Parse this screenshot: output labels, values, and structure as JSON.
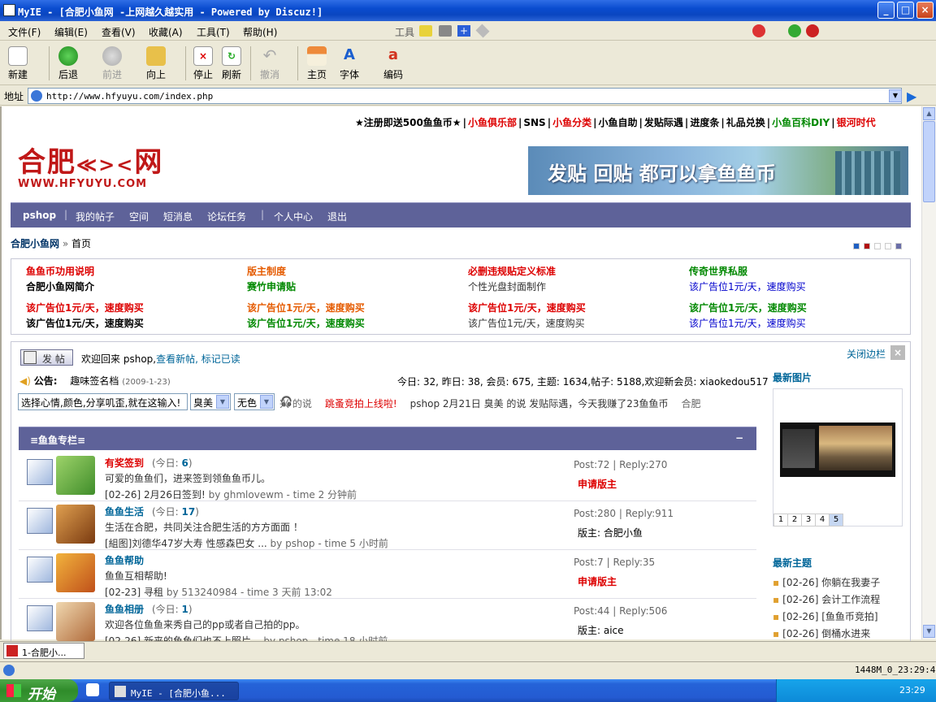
{
  "window": {
    "title": "MyIE - [合肥小鱼网 -上网越久越实用 - Powered by Discuz!]",
    "min": "_",
    "max": "□",
    "close": "×"
  },
  "menu": [
    "文件(F)",
    "编辑(E)",
    "查看(V)",
    "收藏(A)",
    "工具(T)",
    "帮助(H)"
  ],
  "menu_right_label": "工具",
  "toolbar": {
    "new": "新建",
    "back": "后退",
    "forward": "前进",
    "up": "向上",
    "stop": "停止",
    "refresh": "刷新",
    "undo": "撤消",
    "home": "主页",
    "font": "字体",
    "encoding": "编码"
  },
  "address": {
    "label": "地址",
    "url": "http://www.hfyuyu.com/index.php"
  },
  "toplinks": [
    {
      "text": "★注册即送500鱼鱼币★",
      "color": "#000"
    },
    {
      "text": "|",
      "color": "#000"
    },
    {
      "text": "小鱼俱乐部",
      "color": "#d00"
    },
    {
      "text": "|",
      "color": "#000"
    },
    {
      "text": "SNS",
      "color": "#000"
    },
    {
      "text": "|",
      "color": "#000"
    },
    {
      "text": "小鱼分类",
      "color": "#d00"
    },
    {
      "text": "|",
      "color": "#000"
    },
    {
      "text": "小鱼自助",
      "color": "#000"
    },
    {
      "text": "|",
      "color": "#000"
    },
    {
      "text": "发贴际遇",
      "color": "#000"
    },
    {
      "text": "|",
      "color": "#000"
    },
    {
      "text": "进度条",
      "color": "#000"
    },
    {
      "text": "|",
      "color": "#000"
    },
    {
      "text": "礼品兑换",
      "color": "#000"
    },
    {
      "text": "|",
      "color": "#000"
    },
    {
      "text": "小鱼百科DIY",
      "color": "#080"
    },
    {
      "text": "|",
      "color": "#000"
    },
    {
      "text": "银河时代",
      "color": "#d00"
    }
  ],
  "logo": {
    "name": "合肥",
    "fish": "≪><",
    "suffix": "网",
    "url": "WWW.HFYUYU.COM"
  },
  "banner": {
    "text": "发贴 回贴 都可以拿鱼鱼币"
  },
  "nav": {
    "user": "pshop",
    "items": [
      "我的帖子",
      "空间",
      "短消息",
      "论坛任务",
      "个人中心",
      "退出"
    ],
    "sep": "|"
  },
  "breadcrumb": {
    "home": "合肥小鱼网",
    "sep": "»",
    "current": "首页"
  },
  "style_colors": [
    "#1f5fc2",
    "#b01010",
    "#ffffff",
    "#ffffff",
    "#6a6ea8"
  ],
  "ads": [
    {
      "text": "鱼鱼币功用说明",
      "color": "#d00"
    },
    {
      "text": "版主制度",
      "color": "#e55b00"
    },
    {
      "text": "必删违规贴定义标准",
      "color": "#d00"
    },
    {
      "text": "传奇世界私服",
      "color": "#080"
    },
    {
      "text": "合肥小鱼网简介",
      "color": "#000"
    },
    {
      "text": "赛竹申请贴",
      "color": "#080"
    },
    {
      "text": "个性光盘封面制作",
      "color": "#333"
    },
    {
      "text": "该广告位1元/天，速度购买",
      "color": "#00c"
    },
    {
      "text": "该广告位1元/天，速度购买",
      "color": "#d00"
    },
    {
      "text": "该广告位1元/天，速度购买",
      "color": "#e55b00"
    },
    {
      "text": "该广告位1元/天，速度购买",
      "color": "#d00"
    },
    {
      "text": "该广告位1元/天，速度购买",
      "color": "#080"
    },
    {
      "text": "该广告位1元/天，速度购买",
      "color": "#000"
    },
    {
      "text": "该广告位1元/天，速度购买",
      "color": "#080"
    },
    {
      "text": "该广告位1元/天，速度购买",
      "color": "#333"
    },
    {
      "text": "该广告位1元/天，速度购买",
      "color": "#00c"
    }
  ],
  "post_button": "发 帖",
  "welcome": {
    "prefix": "欢迎回来",
    "user": "pshop,",
    "newposts": "查看新帖,",
    "markread": "标记已读"
  },
  "close_sidebar": "关闭边栏",
  "announce": {
    "label": "公告:",
    "title": "趣味签名档",
    "date": "(2009-1-23)"
  },
  "stats": "今日: 32, 昨日: 38, 会员: 675, 主题: 1634,帖子: 5188,欢迎新会员: xiaokedou517",
  "mood": {
    "input": "选择心情,颜色,分享叽歪,就在这输入!",
    "emotion": "臭美",
    "color": "无色"
  },
  "ticker": [
    {
      "text": "兴 的说",
      "color": "#666"
    },
    {
      "text": "跳蚤竞拍上线啦!",
      "color": "#d00"
    },
    {
      "text": "pshop 2月21日 臭美 的说 发贴际遇，今天我赚了23鱼鱼币",
      "color": "#333"
    },
    {
      "text": "合肥",
      "color": "#666"
    }
  ],
  "category": {
    "title": "≡鱼鱼专栏≡",
    "collapse": "−"
  },
  "forums": [
    {
      "name": "有奖签到",
      "name_color": "#d00",
      "today_label": "(今日: ",
      "today": "6",
      "today_end": ")",
      "desc": "可爱的鱼鱼们，进来签到领鱼鱼币儿。",
      "last": "[02-26] 2月26日签到!",
      "by": "by ghmlovewm - time 2 分钟前",
      "stat": "Post:72 | Reply:270",
      "mod": "申请版主",
      "mod_apply": true
    },
    {
      "name": "鱼鱼生活",
      "name_color": "#069",
      "today_label": "(今日: ",
      "today": "17",
      "today_end": ")",
      "desc": "生活在合肥，共同关注合肥生活的方方面面 ！",
      "last": "[組图]刘德华47岁大寿 性感森巴女 ...",
      "by": "by pshop - time 5 小时前",
      "stat": "Post:280 | Reply:911",
      "mod": "版主: 合肥小鱼",
      "mod_apply": false
    },
    {
      "name": "鱼鱼帮助",
      "name_color": "#069",
      "today_label": "",
      "today": "",
      "today_end": "",
      "desc": "鱼鱼互相帮助!",
      "last": "[02-23] 寻租",
      "by": "by 513240984 - time 3 天前 13:02",
      "stat": "Post:7 | Reply:35",
      "mod": "申请版主",
      "mod_apply": true
    },
    {
      "name": "鱼鱼相册",
      "name_color": "#069",
      "today_label": "(今日: ",
      "today": "1",
      "today_end": ")",
      "desc": "欢迎各位鱼鱼来秀自己的pp或者自己拍的pp。",
      "last": "[02-26] 新来的鱼鱼们也不上照片...",
      "by": "by pshop - time 18 小时前",
      "stat": "Post:44 | Reply:506",
      "mod": "版主: aice",
      "mod_apply": false
    }
  ],
  "sidebar": {
    "images_title": "最新图片",
    "pager": [
      "1",
      "2",
      "3",
      "4",
      "5"
    ],
    "pager_active": 4,
    "topics_title": "最新主题",
    "topics": [
      "[02-26] 你躺在我妻子",
      "[02-26] 会计工作流程",
      "[02-26] [鱼鱼币竞拍]",
      "[02-26] 倒桶水进来"
    ]
  },
  "tab": {
    "label": "1-合肥小..."
  },
  "status": {
    "right": "1448M_0_23:29:47"
  },
  "taskbar": {
    "start": "开始",
    "item": "MyIE - [合肥小鱼...",
    "clock": "23:29"
  }
}
